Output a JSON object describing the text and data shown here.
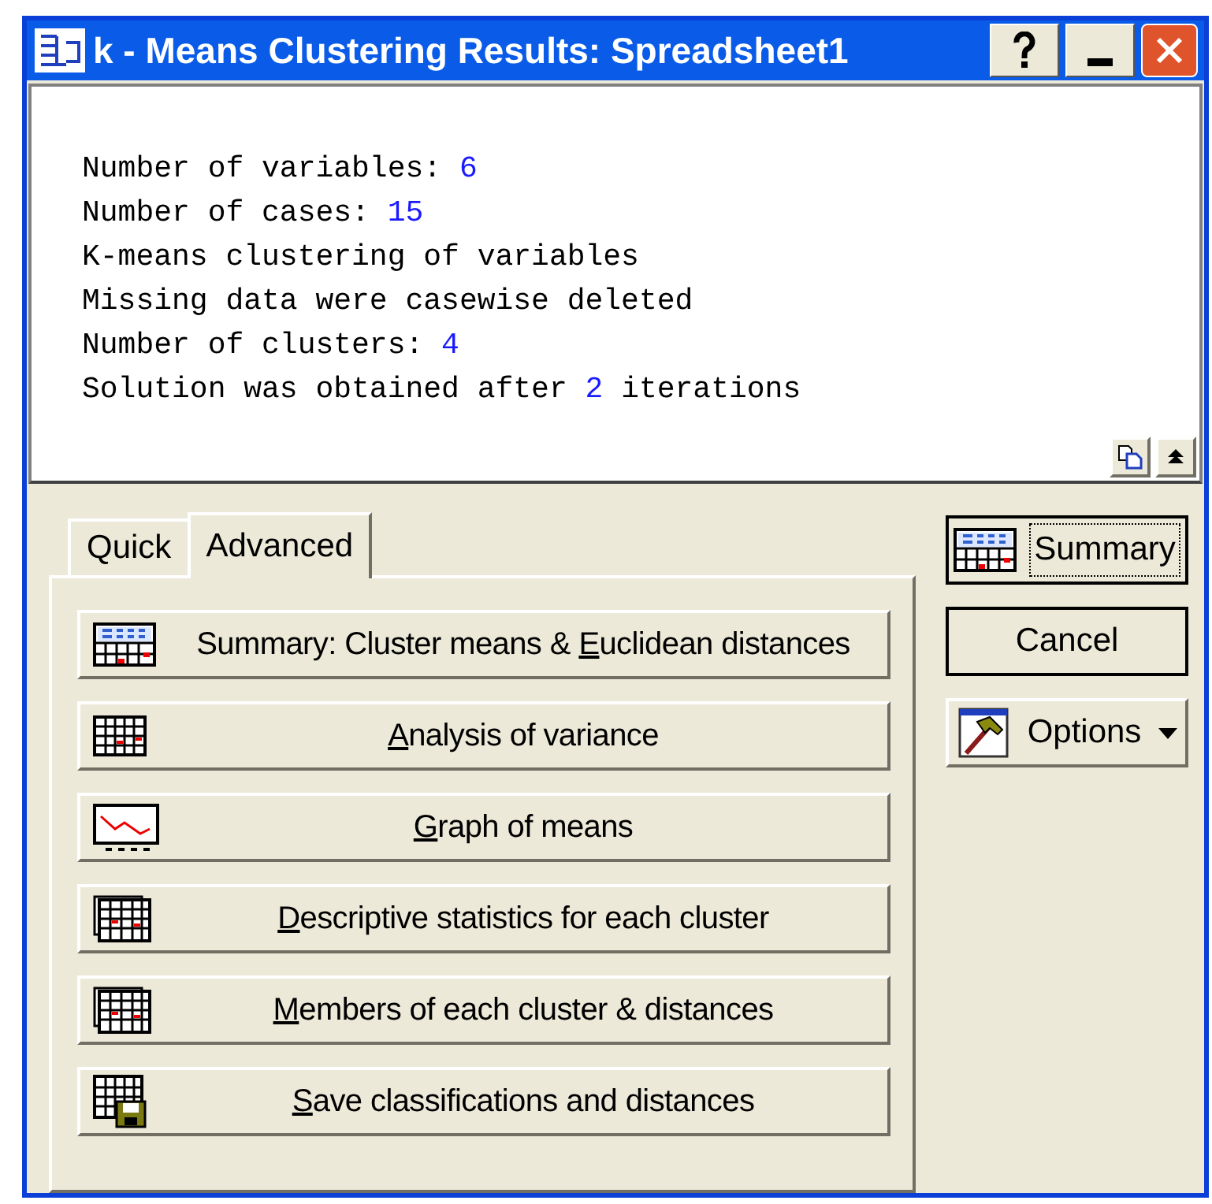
{
  "window": {
    "title": "k - Means Clustering Results: Spreadsheet1"
  },
  "output_lines": [
    {
      "text": "Number of variables: ",
      "value": "6"
    },
    {
      "text": "Number of cases: ",
      "value": "15"
    },
    {
      "text": "K-means clustering of variables"
    },
    {
      "text": "Missing data were casewise deleted"
    },
    {
      "text": "Number of clusters: ",
      "value": "4"
    },
    {
      "text": "Solution was obtained after ",
      "value": "2",
      "suffix": " iterations"
    }
  ],
  "tabs": [
    {
      "label": "Quick",
      "selected": false
    },
    {
      "label": "Advanced",
      "selected": true
    }
  ],
  "actions": [
    {
      "kind": "summ",
      "before": "Summary: Cluster means & ",
      "key": "E",
      "after": "uclidean distances"
    },
    {
      "kind": "grid",
      "key": "A",
      "after": "nalysis of variance"
    },
    {
      "kind": "graph",
      "key": "G",
      "after": "raph of means"
    },
    {
      "kind": "stack",
      "key": "D",
      "after": "escriptive statistics for each cluster"
    },
    {
      "kind": "stack",
      "key": "M",
      "after": "embers of each cluster & distances"
    },
    {
      "kind": "save",
      "key": "S",
      "after": "ave classifications and distances"
    }
  ],
  "side_buttons": [
    {
      "kind": "summ",
      "label": "Summary",
      "focused": true
    },
    {
      "kind": "plain",
      "label": "Cancel",
      "focused": false
    },
    {
      "kind": "options",
      "label": "Options",
      "focused": false
    }
  ]
}
